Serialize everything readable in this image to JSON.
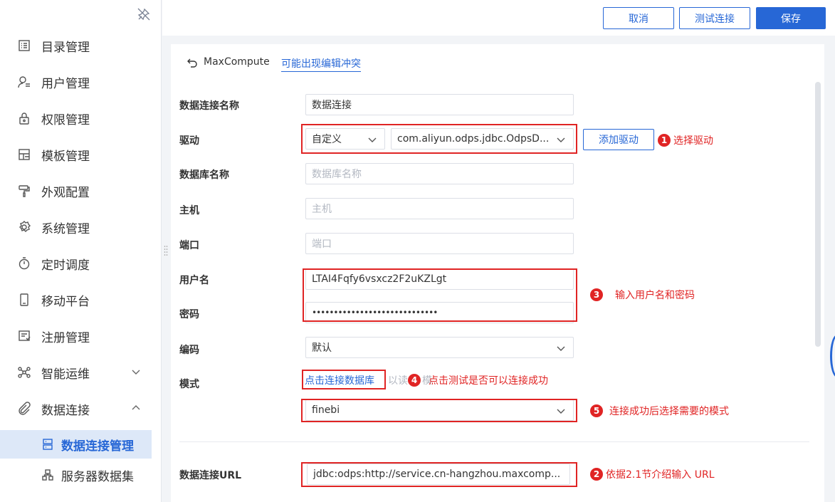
{
  "sidebar": {
    "items": [
      {
        "label": "目录管理",
        "icon": "catalog-icon"
      },
      {
        "label": "用户管理",
        "icon": "user-icon"
      },
      {
        "label": "权限管理",
        "icon": "lock-icon"
      },
      {
        "label": "模板管理",
        "icon": "template-icon"
      },
      {
        "label": "外观配置",
        "icon": "paint-roller-icon"
      },
      {
        "label": "系统管理",
        "icon": "gear-icon"
      },
      {
        "label": "定时调度",
        "icon": "timer-icon"
      },
      {
        "label": "移动平台",
        "icon": "mobile-icon"
      },
      {
        "label": "注册管理",
        "icon": "register-icon"
      },
      {
        "label": "智能运维",
        "icon": "ops-icon"
      },
      {
        "label": "数据连接",
        "icon": "link-icon"
      }
    ],
    "sub_items": [
      {
        "label": "数据连接管理",
        "icon": "database-icon",
        "active": true
      },
      {
        "label": "服务器数据集",
        "icon": "dataset-icon",
        "active": false
      }
    ]
  },
  "toolbar": {
    "cancel_label": "取消",
    "test_label": "测试连接",
    "save_label": "保存"
  },
  "breadcrumb": {
    "title": "MaxCompute",
    "link": "可能出现编辑冲突"
  },
  "form": {
    "name_label": "数据连接名称",
    "name_value": "数据连接",
    "driver_label": "驱动",
    "driver_type": "自定义",
    "driver_class": "com.aliyun.odps.jdbc.OdpsD...",
    "add_driver_label": "添加驱动",
    "db_label": "数据库名称",
    "db_placeholder": "数据库名称",
    "host_label": "主机",
    "host_placeholder": "主机",
    "port_label": "端口",
    "port_placeholder": "端口",
    "user_label": "用户名",
    "user_value": "LTAI4Fqfy6vsxcz2F2uKZLgt",
    "password_label": "密码",
    "password_value": "•••••••••••••••••••••••••••••",
    "encoding_label": "编码",
    "encoding_value": "默认",
    "schema_label": "模式",
    "schema_link": "点击连接数据库",
    "schema_hint": "以读",
    "schema_hint_tail": "模",
    "schema_value": "finebi",
    "url_label": "数据连接URL",
    "url_value": "jdbc:odps:http://service.cn-hangzhou.maxcomp..."
  },
  "annotations": [
    {
      "num": "1",
      "text": "选择驱动"
    },
    {
      "num": "2",
      "text": "依据2.1节介绍输入 URL"
    },
    {
      "num": "3",
      "text": "输入用户名和密码"
    },
    {
      "num": "4",
      "text": "点击测试是否可以连接成功"
    },
    {
      "num": "5",
      "text": "连接成功后选择需要的模式"
    }
  ],
  "colors": {
    "accent": "#2767d6",
    "annotation": "#e02424"
  }
}
